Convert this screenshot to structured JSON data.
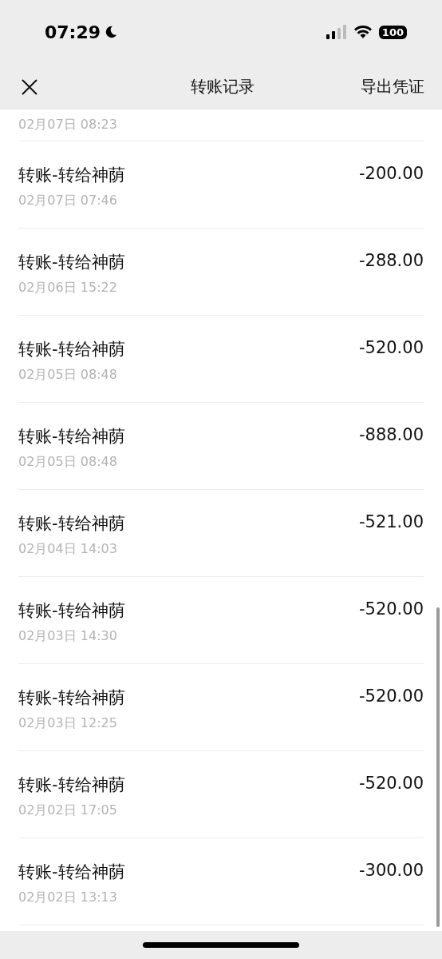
{
  "status_bar": {
    "time": "07:29",
    "battery": "100"
  },
  "nav": {
    "title": "转账记录",
    "action": "导出凭证"
  },
  "partial_date": "02月07日 08:23",
  "records": [
    {
      "title": "转账-转给神荫",
      "date": "02月07日 07:46",
      "amount": "-200.00"
    },
    {
      "title": "转账-转给神荫",
      "date": "02月06日 15:22",
      "amount": "-288.00"
    },
    {
      "title": "转账-转给神荫",
      "date": "02月05日 08:48",
      "amount": "-520.00"
    },
    {
      "title": "转账-转给神荫",
      "date": "02月05日 08:48",
      "amount": "-888.00"
    },
    {
      "title": "转账-转给神荫",
      "date": "02月04日 14:03",
      "amount": "-521.00"
    },
    {
      "title": "转账-转给神荫",
      "date": "02月03日 14:30",
      "amount": "-520.00"
    },
    {
      "title": "转账-转给神荫",
      "date": "02月03日 12:25",
      "amount": "-520.00"
    },
    {
      "title": "转账-转给神荫",
      "date": "02月02日 17:05",
      "amount": "-520.00"
    },
    {
      "title": "转账-转给神荫",
      "date": "02月02日 13:13",
      "amount": "-300.00"
    }
  ]
}
